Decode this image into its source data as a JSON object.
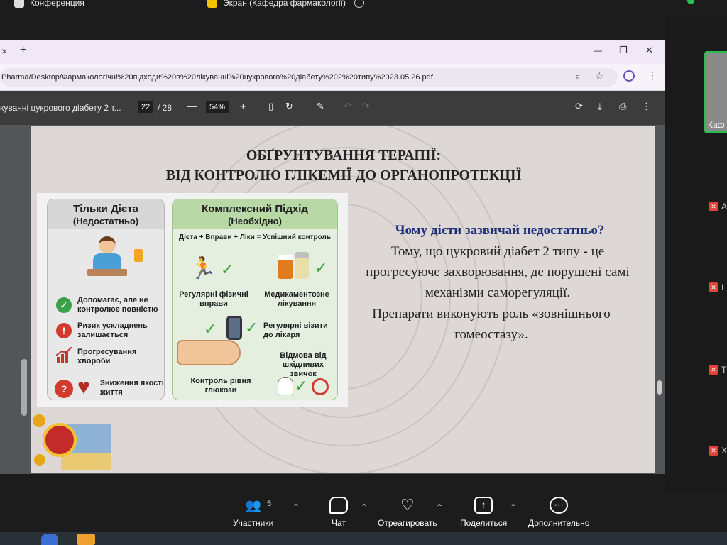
{
  "meeting": {
    "tab1_label": "Конференция",
    "tab2_label": "Экран (Кафедра фармакології)",
    "right_panel": {
      "thumb_label": "Каф",
      "participants": [
        "А",
        "І",
        "Т",
        "Х"
      ]
    },
    "bottom_bar": {
      "participants_label": "Участники",
      "participants_count": "5",
      "chat_label": "Чат",
      "react_label": "Отреагировать",
      "share_label": "Поделиться",
      "more_label": "Дополнительно"
    }
  },
  "browser": {
    "url": "Pharma/Desktop/Фармакологічні%20підходи%20в%20лікуванні%20цукрового%20діабету%202%20типу%2023.05.26.pdf",
    "tab_close": "×",
    "tab_new": "+",
    "win_min": "—",
    "win_restore": "❐",
    "win_close": "✕"
  },
  "pdf": {
    "doc_title": "куванні цукрового діабету 2 т...",
    "page_current": "22",
    "page_total": "/ 28",
    "zoom": "54%",
    "minus": "—",
    "plus": "+"
  },
  "slide": {
    "title_line1": "ОБҐРУНТУВАННЯ ТЕРАПІЇ:",
    "title_line2": "ВІД КОНТРОЛЮ ГЛІКЕМІЇ ДО ОРГАНОПРОТЕКЦІЇ",
    "question": "Чому дієти зазвичай недостатньо?",
    "para1": "Тому, що цукровий діабет 2 типу - це прогресуюче захворювання, де порушені самі механізми саморегуляції.",
    "para2": "Препарати виконують роль «зовнішнього гомеостазу».",
    "left_card": {
      "title": "Тільки Дієта",
      "subtitle": "(Недостатньо)",
      "items": [
        "Допомагає, але не контролює повністю",
        "Ризик ускладнень залишається",
        "Прогресування хвороби",
        "Зниження якості життя"
      ]
    },
    "right_card": {
      "title": "Комплексний Підхід",
      "subtitle": "(Необхідно)",
      "formula": "Дієта + Вправи + Ліки = Успішний контроль",
      "items": [
        "Регулярні фізичні вправи",
        "Медикаментозне лікування",
        "Регулярні візити до лікаря",
        "Відмова від шкідливих звичок",
        "Контроль рівня глюкози"
      ]
    }
  }
}
